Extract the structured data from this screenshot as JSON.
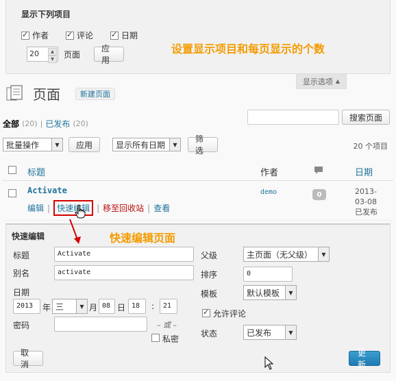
{
  "screen_options": {
    "title": "显示下列项目",
    "columns": [
      {
        "label": "作者",
        "checked": true
      },
      {
        "label": "评论",
        "checked": true
      },
      {
        "label": "日期",
        "checked": true
      }
    ],
    "per_page_value": "20",
    "per_page_label": "页面",
    "apply_label": "应用",
    "tab_label": "显示选项"
  },
  "annotations": {
    "screen_options_note": "设置显示项目和每页显示的个数",
    "quick_edit_note": "快速编辑页面"
  },
  "header": {
    "title": "页面",
    "add_new": "新建页面"
  },
  "views": {
    "all_label": "全部",
    "all_count": "(20)",
    "separator": "|",
    "published_label": "已发布",
    "published_count": "(20)"
  },
  "search": {
    "button_label": "搜索页面"
  },
  "tablenav": {
    "bulk_actions": "批量操作",
    "apply_label": "应用",
    "dates": "显示所有日期",
    "filter_label": "筛选",
    "item_count": "20 个项目"
  },
  "table": {
    "columns": {
      "title": "标题",
      "author": "作者",
      "date": "日期"
    },
    "rows": [
      {
        "title": "Activate",
        "actions": {
          "edit": "编辑",
          "quick_edit": "快速编辑",
          "trash": "移至回收站",
          "view": "查看"
        },
        "author": "demo",
        "comments": "0",
        "date_line1": "2013-",
        "date_line2": "03-08",
        "status": "已发布"
      }
    ]
  },
  "quick_edit": {
    "heading": "快速编辑",
    "title_label": "标题",
    "title_value": "Activate",
    "slug_label": "别名",
    "slug_value": "activate",
    "date_label": "日期",
    "year": "2013",
    "year_suffix": "年",
    "month": "三",
    "month_suffix": "月",
    "day": "08",
    "day_suffix": "日",
    "hour": "18",
    "colon": ":",
    "minute": "21",
    "password_label": "密码",
    "or_label": "– 或 –",
    "private_label": "私密",
    "parent_label": "父级",
    "parent_value": "主页面（无父级）",
    "order_label": "排序",
    "order_value": "0",
    "template_label": "模板",
    "template_value": "默认模板",
    "allow_comments_label": "允许评论",
    "status_label": "状态",
    "status_value": "已发布",
    "cancel_label": "取消",
    "update_label": "更新"
  },
  "colors": {
    "link": "#21759b",
    "annotation_orange": "#f39c00",
    "highlight_red": "#d40000",
    "primary_button": "#1f7ab0"
  }
}
